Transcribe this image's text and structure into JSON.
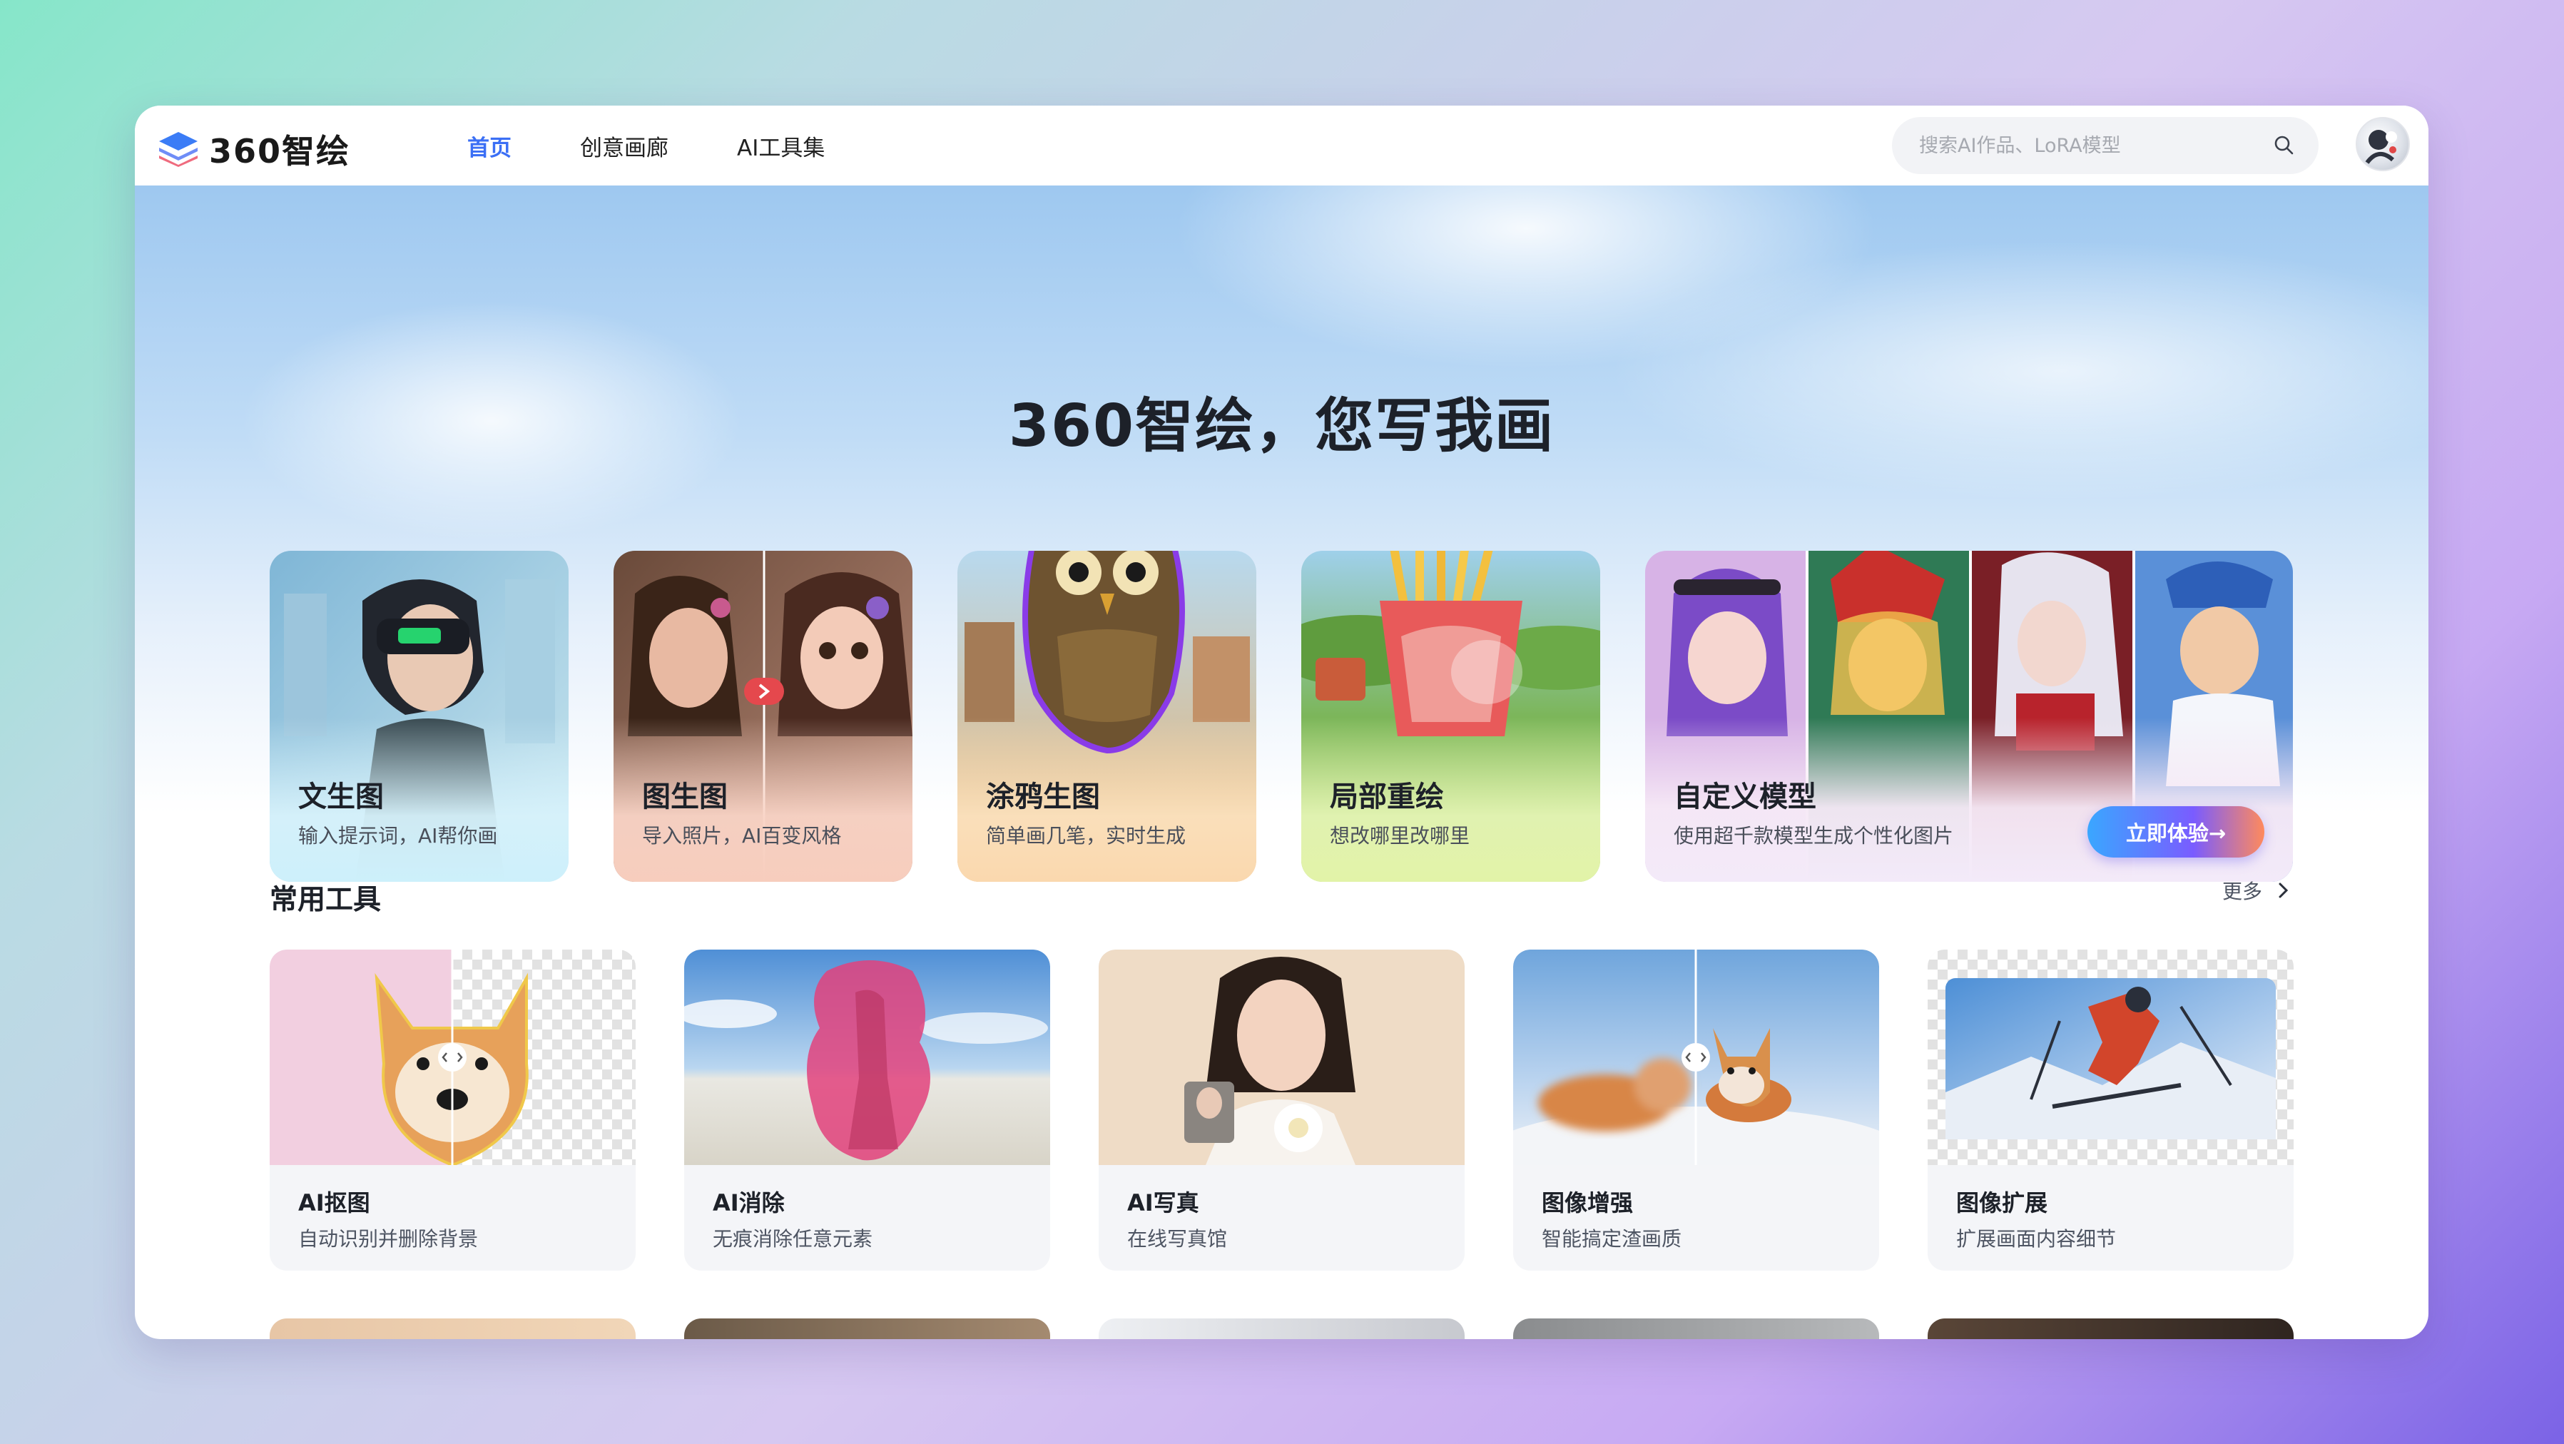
{
  "app": {
    "logo_text": "360智绘"
  },
  "nav": {
    "items": [
      "首页",
      "创意画廊",
      "AI工具集"
    ],
    "active_index": 0
  },
  "search": {
    "placeholder": "搜索AI作品、LoRA模型",
    "value": ""
  },
  "hero": {
    "title": "360智绘，您写我画",
    "features": [
      {
        "title": "文生图",
        "subtitle": "输入提示词，AI帮你画"
      },
      {
        "title": "图生图",
        "subtitle": "导入照片，AI百变风格"
      },
      {
        "title": "涂鸦生图",
        "subtitle": "简单画几笔，实时生成"
      },
      {
        "title": "局部重绘",
        "subtitle": "想改哪里改哪里"
      },
      {
        "title": "自定义模型",
        "subtitle": "使用超千款模型生成个性化图片",
        "button": "立即体验→"
      }
    ]
  },
  "tools": {
    "title": "常用工具",
    "more": "更多",
    "items": [
      {
        "title": "AI抠图",
        "subtitle": "自动识别并删除背景"
      },
      {
        "title": "AI消除",
        "subtitle": "无痕消除任意元素"
      },
      {
        "title": "AI写真",
        "subtitle": "在线写真馆"
      },
      {
        "title": "图像增强",
        "subtitle": "智能搞定渣画质"
      },
      {
        "title": "图像扩展",
        "subtitle": "扩展画面内容细节"
      }
    ]
  },
  "colors": {
    "accent": "#3b6ff5",
    "text": "#1d2129",
    "card_bg": "#f4f5f8"
  }
}
